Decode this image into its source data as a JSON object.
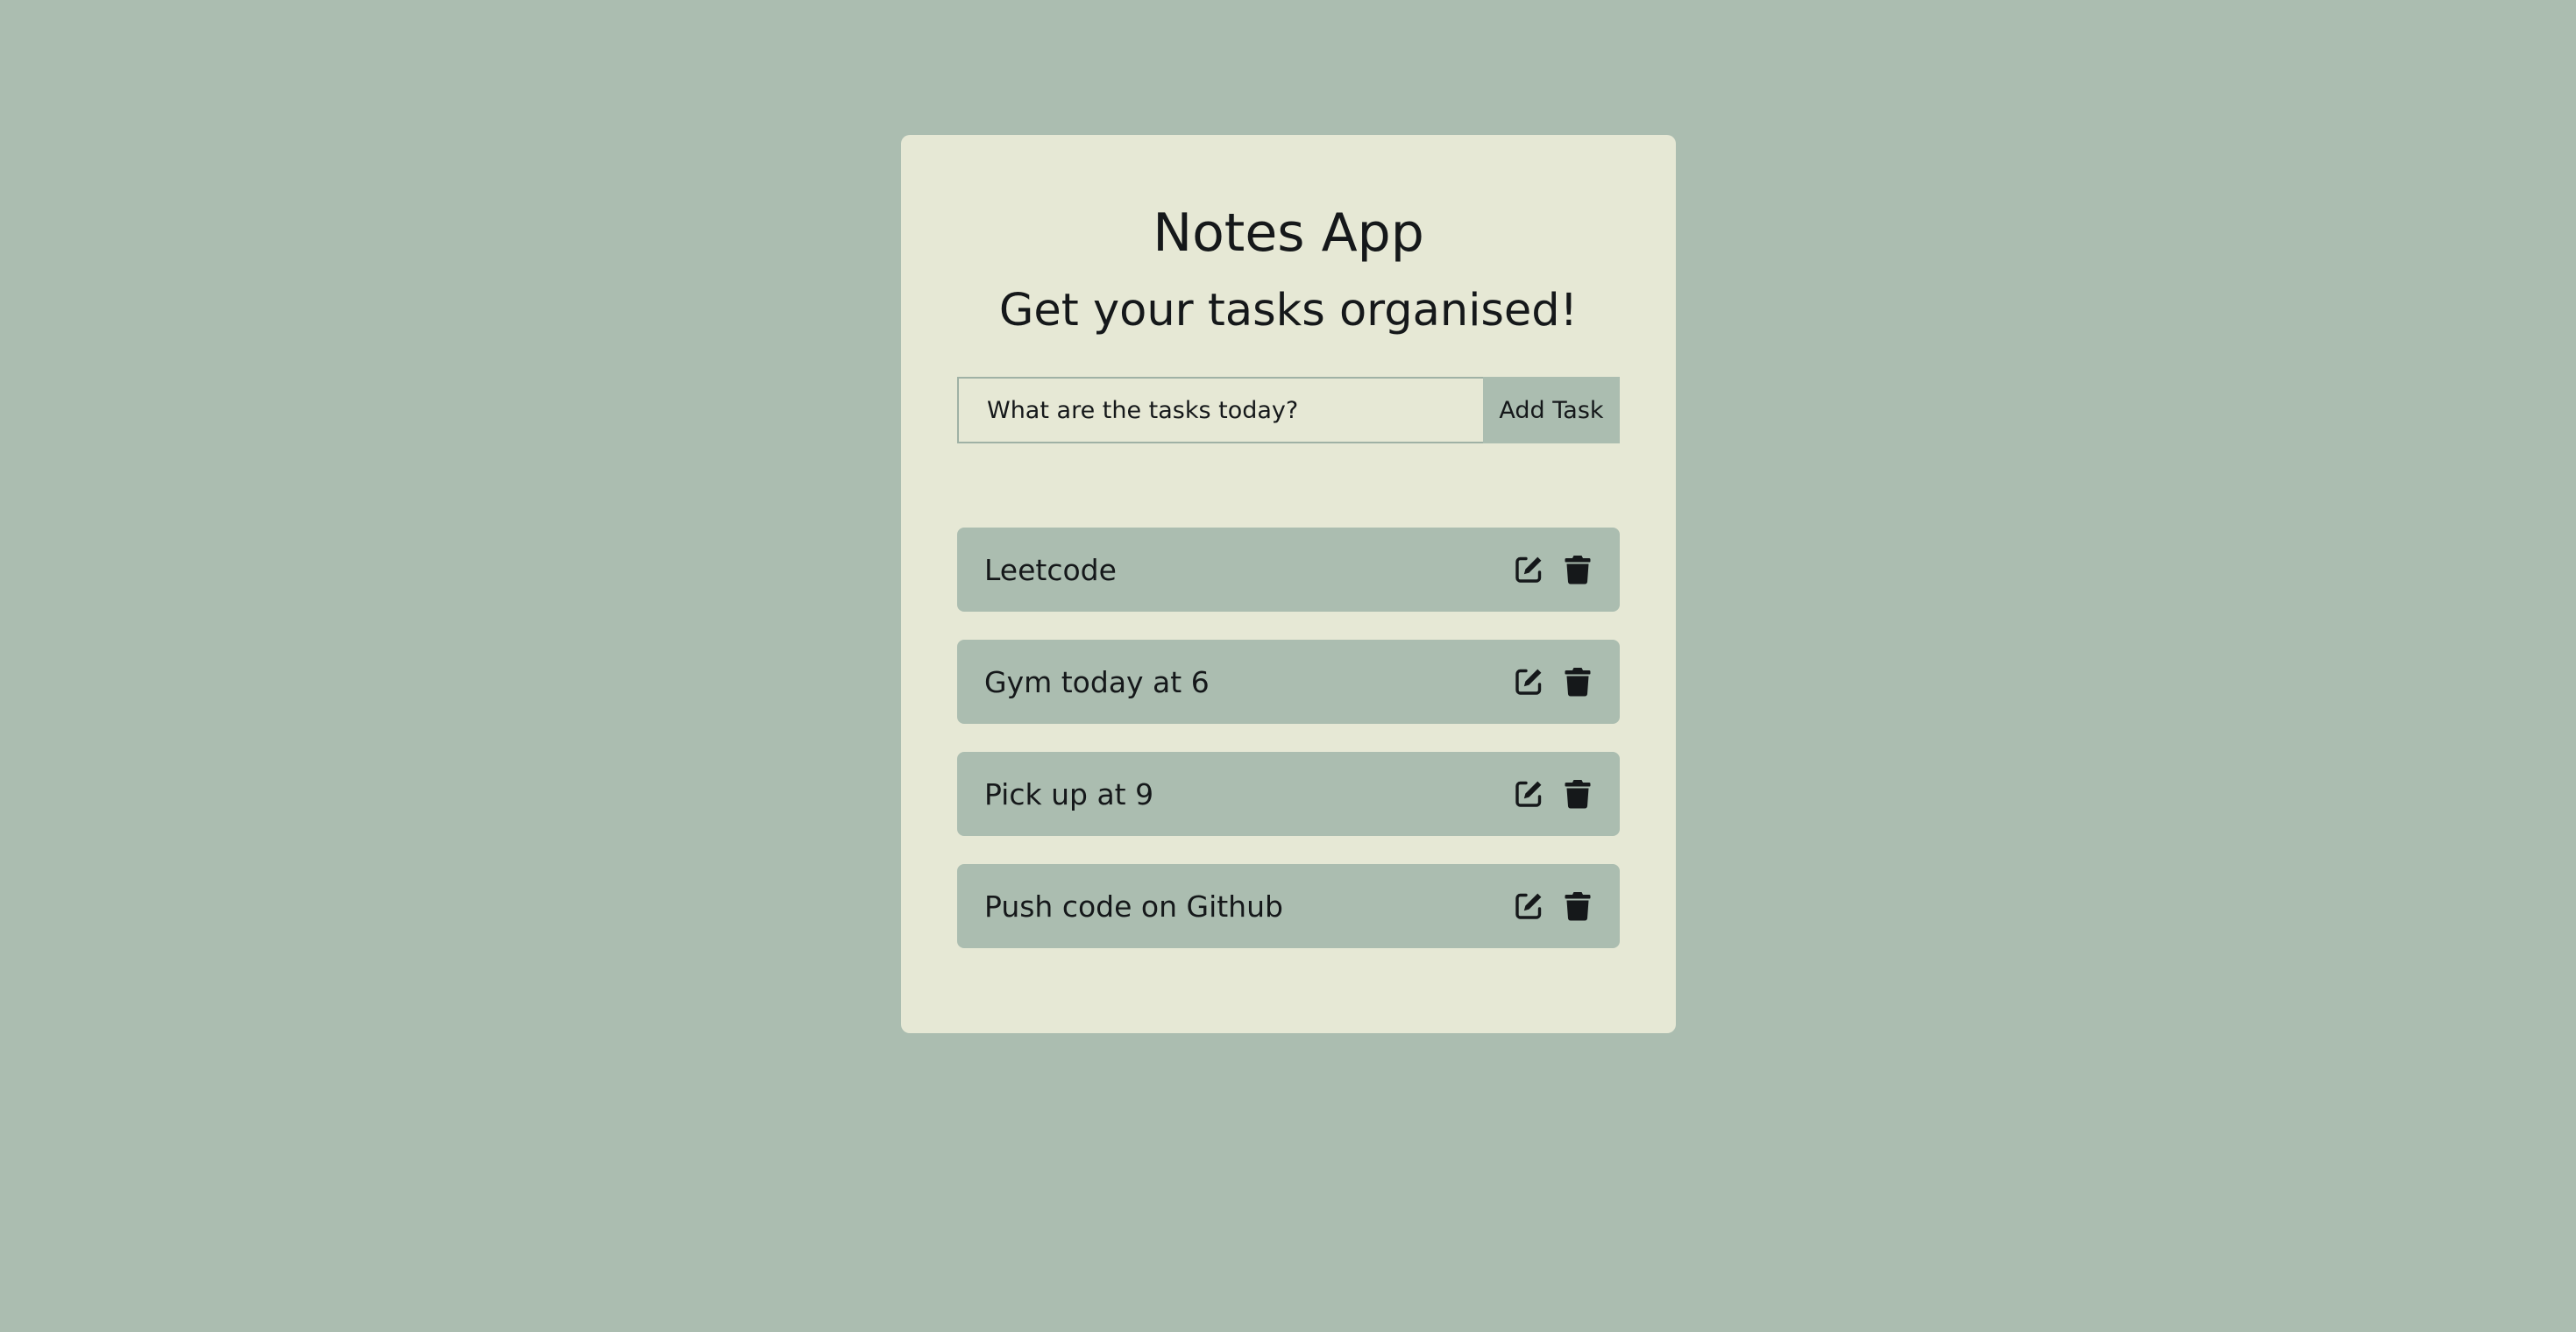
{
  "app": {
    "title": "Notes App",
    "subtitle": "Get your tasks organised!"
  },
  "add_task": {
    "placeholder": "What are the tasks today?",
    "button_label": "Add Task"
  },
  "tasks": [
    {
      "text": "Leetcode",
      "edit_icon": "edit-icon",
      "delete_icon": "trash-icon"
    },
    {
      "text": "Gym today at 6",
      "edit_icon": "edit-icon",
      "delete_icon": "trash-icon"
    },
    {
      "text": "Pick up at 9",
      "edit_icon": "edit-icon",
      "delete_icon": "trash-icon"
    },
    {
      "text": "Push code on Github",
      "edit_icon": "edit-icon",
      "delete_icon": "trash-icon"
    }
  ],
  "colors": {
    "page_background": "#abbdb0",
    "card_background": "#e6e8d5",
    "task_background": "#abbdb0",
    "text": "#15181a"
  }
}
